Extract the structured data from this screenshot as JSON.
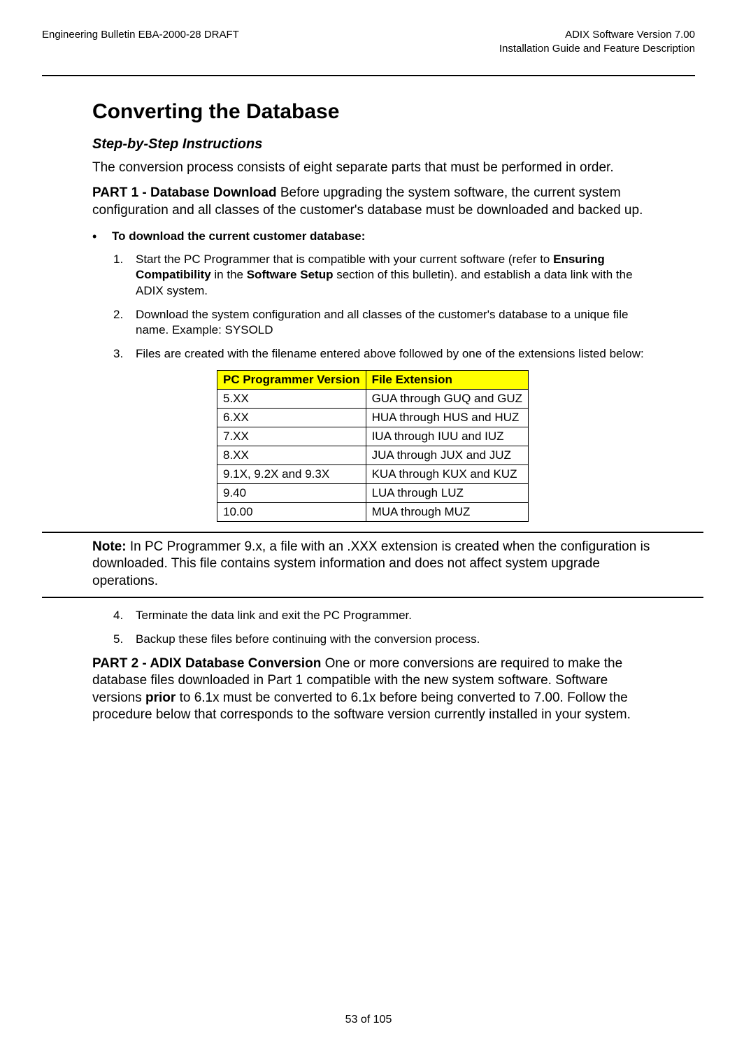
{
  "header": {
    "left": "Engineering Bulletin EBA-2000-28 DRAFT",
    "right1": "ADIX Software Version 7.00",
    "right2": "Installation Guide and Feature Description"
  },
  "title": "Converting the Database",
  "subtitle": "Step-by-Step Instructions",
  "intro": "The conversion process consists of eight separate parts that must be performed in order.",
  "part1": {
    "lead": "PART 1 - Database Download",
    "text": "   Before upgrading the system software, the current system configuration and all classes of the customer's database must be downloaded and backed up."
  },
  "bullet_heading": "To download the current customer database:",
  "steps_a": [
    {
      "num": "1.",
      "pre": "Start the PC Programmer that is compatible with your current software (refer to ",
      "b1": "Ensuring Compatibility",
      "mid": " in the ",
      "b2": "Software Setup",
      "post": " section of this bulletin). and establish a data link with the ADIX system."
    },
    {
      "num": "2.",
      "plain": "Download the system configuration and all classes of the customer's database to a unique file name. Example: SYSOLD"
    },
    {
      "num": "3.",
      "plain": "Files are created with the filename entered above followed by one of the extensions listed below:"
    }
  ],
  "table": {
    "headers": [
      "PC Programmer Version",
      "File Extension"
    ],
    "rows": [
      [
        "5.XX",
        "GUA through GUQ and GUZ"
      ],
      [
        "6.XX",
        "HUA through HUS and HUZ"
      ],
      [
        "7.XX",
        "IUA through IUU and IUZ"
      ],
      [
        "8.XX",
        "JUA through JUX and JUZ"
      ],
      [
        "9.1X, 9.2X and 9.3X",
        "KUA through KUX and KUZ"
      ],
      [
        "9.40",
        "LUA through LUZ"
      ],
      [
        "10.00",
        "MUA through MUZ"
      ]
    ]
  },
  "note": {
    "lead": "Note:",
    "text": "  In PC Programmer 9.x, a file with an .XXX extension is created when the configuration is downloaded.  This file contains system information and does not affect system upgrade operations."
  },
  "steps_b": [
    {
      "num": "4.",
      "plain": "Terminate the data link and exit the PC Programmer."
    },
    {
      "num": "5.",
      "plain": "Backup these files before continuing with the conversion process."
    }
  ],
  "part2": {
    "lead": "PART 2 - ADIX Database Conversion",
    "pre": "   One or more conversions are required to make the database files downloaded in Part 1 compatible with the new system software. Software versions ",
    "b": "prior",
    "post": " to 6.1x must be converted to 6.1x before being converted to 7.00. Follow the procedure below that corresponds to the software version currently installed in your system."
  },
  "footer": "53 of 105"
}
